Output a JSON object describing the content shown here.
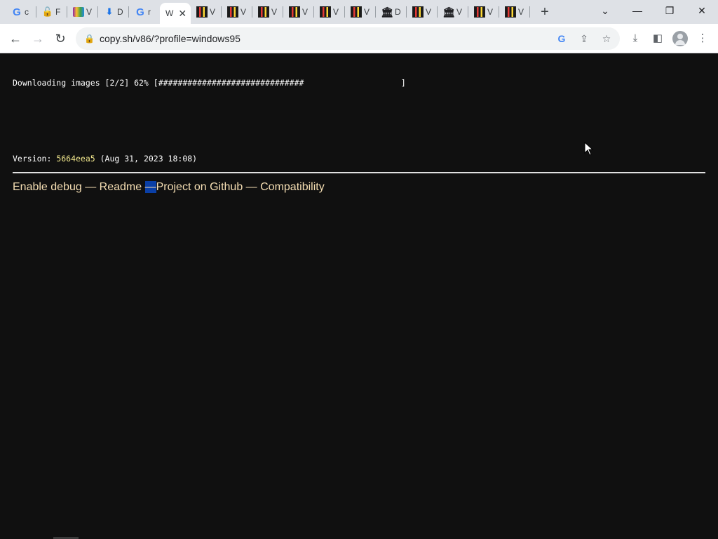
{
  "browser": {
    "tabs": [
      {
        "icon": "google-icon",
        "title": "c"
      },
      {
        "icon": "red-lock-icon",
        "title": "F"
      },
      {
        "icon": "winrar-icon",
        "title": "V"
      },
      {
        "icon": "download-icon",
        "title": "D"
      },
      {
        "icon": "google-icon",
        "title": "r"
      },
      {
        "icon": "none",
        "title": "W",
        "active": true
      },
      {
        "icon": "mosaic-icon",
        "title": "V"
      },
      {
        "icon": "mosaic-icon",
        "title": "V"
      },
      {
        "icon": "mosaic-icon",
        "title": "V"
      },
      {
        "icon": "mosaic-icon",
        "title": "V"
      },
      {
        "icon": "mosaic-icon",
        "title": "V"
      },
      {
        "icon": "mosaic-icon",
        "title": "V"
      },
      {
        "icon": "museum-icon",
        "title": "D"
      },
      {
        "icon": "mosaic-icon",
        "title": "V"
      },
      {
        "icon": "museum-icon",
        "title": "V"
      },
      {
        "icon": "mosaic-icon",
        "title": "V"
      },
      {
        "icon": "mosaic-icon",
        "title": "V"
      }
    ],
    "url": "copy.sh/v86/?profile=windows95"
  },
  "page": {
    "progress_text": "Downloading images [2/2] 62% [##############################                    ]",
    "version_label": "Version: ",
    "version_hash": "5664eea5",
    "version_date": " (Aug 31, 2023 18:08)",
    "links": {
      "debug": "Enable debug",
      "sep1": " — ",
      "readme": "Readme",
      "sep2": "—",
      "github": "Project on Github",
      "sep3": " — ",
      "compat": "Compatibility"
    }
  },
  "colors": {
    "page_bg": "#101010",
    "link": "#f5deb3",
    "hash": "#f0e68c",
    "selection": "#0a3fa6"
  }
}
